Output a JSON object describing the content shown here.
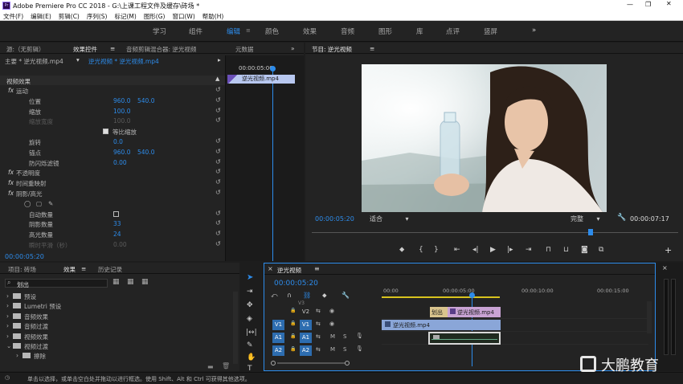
{
  "window": {
    "title": "Adobe Premiere Pro CC 2018 - G:\\上课工程文件及缓存\\砖场 *"
  },
  "menu": [
    "文件(F)",
    "编辑(E)",
    "剪辑(C)",
    "序列(S)",
    "标记(M)",
    "图形(G)",
    "窗口(W)",
    "帮助(H)"
  ],
  "workspaces": [
    "学习",
    "组件",
    "编辑",
    "颜色",
    "效果",
    "音频",
    "图形",
    "库",
    "点评",
    "竖屏"
  ],
  "active_workspace": "编辑",
  "source_panel": {
    "tabs": [
      "源:（无剪辑）",
      "效果控件",
      "音频剪辑混合器: 逆光视频",
      "元数据"
    ],
    "clip_row": {
      "master": "主要 * 逆光视频.mp4",
      "sequence": "逆光视频 * 逆光视频.mp4"
    },
    "mini_timecode": "00:00:05:00",
    "mini_clip": "逆光视频.mp4",
    "section": "视频效果",
    "params": [
      {
        "label": "运动",
        "v1": "",
        "v2": ""
      },
      {
        "label": "位置",
        "v1": "960.0",
        "v2": "540.0"
      },
      {
        "label": "缩放",
        "v1": "100.0",
        "v2": ""
      },
      {
        "label": "缩放宽度",
        "v1": "100.0",
        "v2": ""
      },
      {
        "label": "等比缩放",
        "v1": "",
        "v2": ""
      },
      {
        "label": "旋转",
        "v1": "0.0",
        "v2": ""
      },
      {
        "label": "锚点",
        "v1": "960.0",
        "v2": "540.0"
      },
      {
        "label": "防闪烁滤镜",
        "v1": "0.00",
        "v2": ""
      },
      {
        "label": "不透明度",
        "v1": "",
        "v2": ""
      },
      {
        "label": "时间重映射",
        "v1": "",
        "v2": ""
      },
      {
        "label": "阴影/高光",
        "v1": "",
        "v2": ""
      },
      {
        "label": "",
        "v1": "",
        "v2": ""
      },
      {
        "label": "自动数量",
        "v1": "",
        "v2": ""
      },
      {
        "label": "阴影数量",
        "v1": "33",
        "v2": ""
      },
      {
        "label": "高光数量",
        "v1": "24",
        "v2": ""
      },
      {
        "label": "瞬时平滑（秒）",
        "v1": "0.00",
        "v2": ""
      }
    ],
    "timecode": "00:00:05:20"
  },
  "program_monitor": {
    "title": "节目: 逆光视频",
    "current_time": "00:00:05:20",
    "zoom": "适合",
    "quality": "完整",
    "duration": "00:00:07:17",
    "playhead_fraction": 0.76
  },
  "project_panel": {
    "tabs": [
      "项目: 砖场",
      "效果",
      "历史记录"
    ],
    "search": "划出",
    "tree": [
      "预设",
      "Lumetri 预设",
      "音频效果",
      "音频过渡",
      "视频效果",
      "视频过渡",
      "擦除"
    ]
  },
  "timeline": {
    "title": "逆光视频",
    "timecode": "00:00:05:20",
    "ruler": [
      "00:00",
      "00:00:05:00",
      "00:00:10:00",
      "00:00:15:00"
    ],
    "tracks": [
      {
        "name": "V2",
        "target": ""
      },
      {
        "name": "V1",
        "target": "V1"
      },
      {
        "name": "A1",
        "target": "A1"
      },
      {
        "name": "A2",
        "target": "A2"
      }
    ],
    "top_track_label": "V3",
    "track_icons": [
      "M",
      "S"
    ],
    "clips": {
      "v2_transition": "划出",
      "v2_clip": "逆光视频.mp4",
      "v1_clip": "逆光视频.mp4"
    }
  },
  "status_bar": "单击以选择，或单击空白处并拖动以进行框选。使用 Shift、Alt 和 Ctrl 可获得其他选项。",
  "watermark": "大鹏教育",
  "colors": {
    "accent": "#2d8ceb",
    "panel": "#232323",
    "clip_video": "#8aa6d8",
    "clip_v2": "#c9a3d4"
  }
}
